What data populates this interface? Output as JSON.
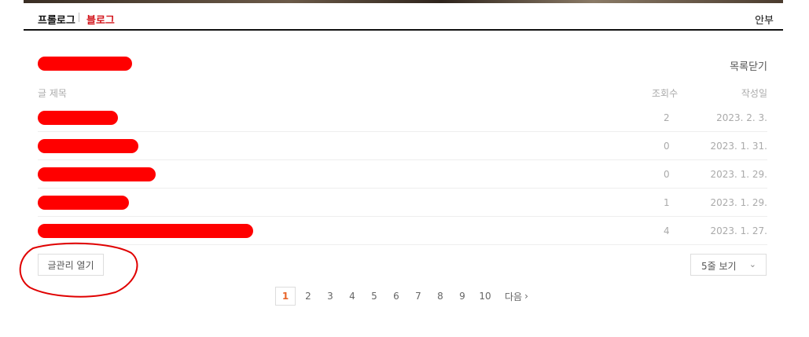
{
  "nav": {
    "prologue": "프롤로그",
    "blog": "블로그",
    "guestbook": "안부"
  },
  "list": {
    "close_label": "목록닫기",
    "columns": {
      "title": "글 제목",
      "views": "조회수",
      "date": "작성일"
    },
    "rows": [
      {
        "views": "2",
        "date": "2023. 2. 3."
      },
      {
        "views": "0",
        "date": "2023. 1. 31."
      },
      {
        "views": "0",
        "date": "2023. 1. 29."
      },
      {
        "views": "1",
        "date": "2023. 1. 29."
      },
      {
        "views": "4",
        "date": "2023. 1. 27."
      }
    ]
  },
  "controls": {
    "manage_label": "글관리 열기",
    "per_page_label": "5줄 보기",
    "chevron_icon": "chevron-down-icon"
  },
  "pagination": {
    "pages": [
      "1",
      "2",
      "3",
      "4",
      "5",
      "6",
      "7",
      "8",
      "9",
      "10"
    ],
    "current": "1",
    "next_label": "다음"
  },
  "colors": {
    "accent_red": "#d2141b",
    "current_page": "#e8652a",
    "redaction": "#ff0000"
  }
}
